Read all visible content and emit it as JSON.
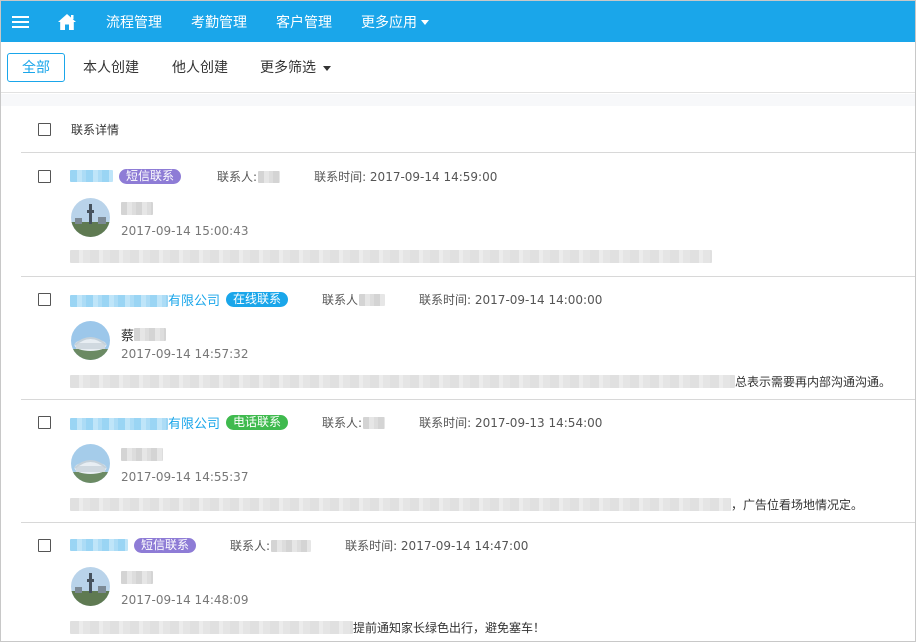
{
  "nav": {
    "items": [
      {
        "label": "流程管理"
      },
      {
        "label": "考勤管理"
      },
      {
        "label": "客户管理"
      },
      {
        "label": "更多应用"
      }
    ]
  },
  "filters": {
    "all": "全部",
    "mine": "本人创建",
    "others": "他人创建",
    "more": "更多筛选"
  },
  "list": {
    "header": "联系详情",
    "records": [
      {
        "company": "",
        "badge": "短信联系",
        "badge_type": "sms",
        "contact_label": "联系人:",
        "time_label": "联系时间: ",
        "time": "2017-09-14 14:59:00",
        "user_name": "",
        "post_time": "2017-09-14 15:00:43",
        "content": ""
      },
      {
        "company": "有限公司",
        "badge": "在线联系",
        "badge_type": "online",
        "contact_label": "联系人",
        "time_label": "联系时间: ",
        "time": "2017-09-14 14:00:00",
        "user_name": "蔡",
        "post_time": "2017-09-14 14:57:32",
        "content": "总表示需要再内部沟通沟通。"
      },
      {
        "company": "有限公司",
        "badge": "电话联系",
        "badge_type": "phone",
        "contact_label": "联系人:",
        "time_label": "联系时间: ",
        "time": "2017-09-13 14:54:00",
        "user_name": "",
        "post_time": "2017-09-14 14:55:37",
        "content": "，广告位看场地情况定。"
      },
      {
        "company": "",
        "badge": "短信联系",
        "badge_type": "sms",
        "contact_label": "联系人:",
        "time_label": "联系时间: ",
        "time": "2017-09-14 14:47:00",
        "user_name": "",
        "post_time": "2017-09-14 14:48:09",
        "content": "提前通知家长绿色出行，避免塞车！"
      }
    ]
  },
  "colors": {
    "accent": "#1aa6ea",
    "badge_sms": "#8e7cd6",
    "badge_online": "#1aa6ea",
    "badge_phone": "#3fba4e"
  }
}
